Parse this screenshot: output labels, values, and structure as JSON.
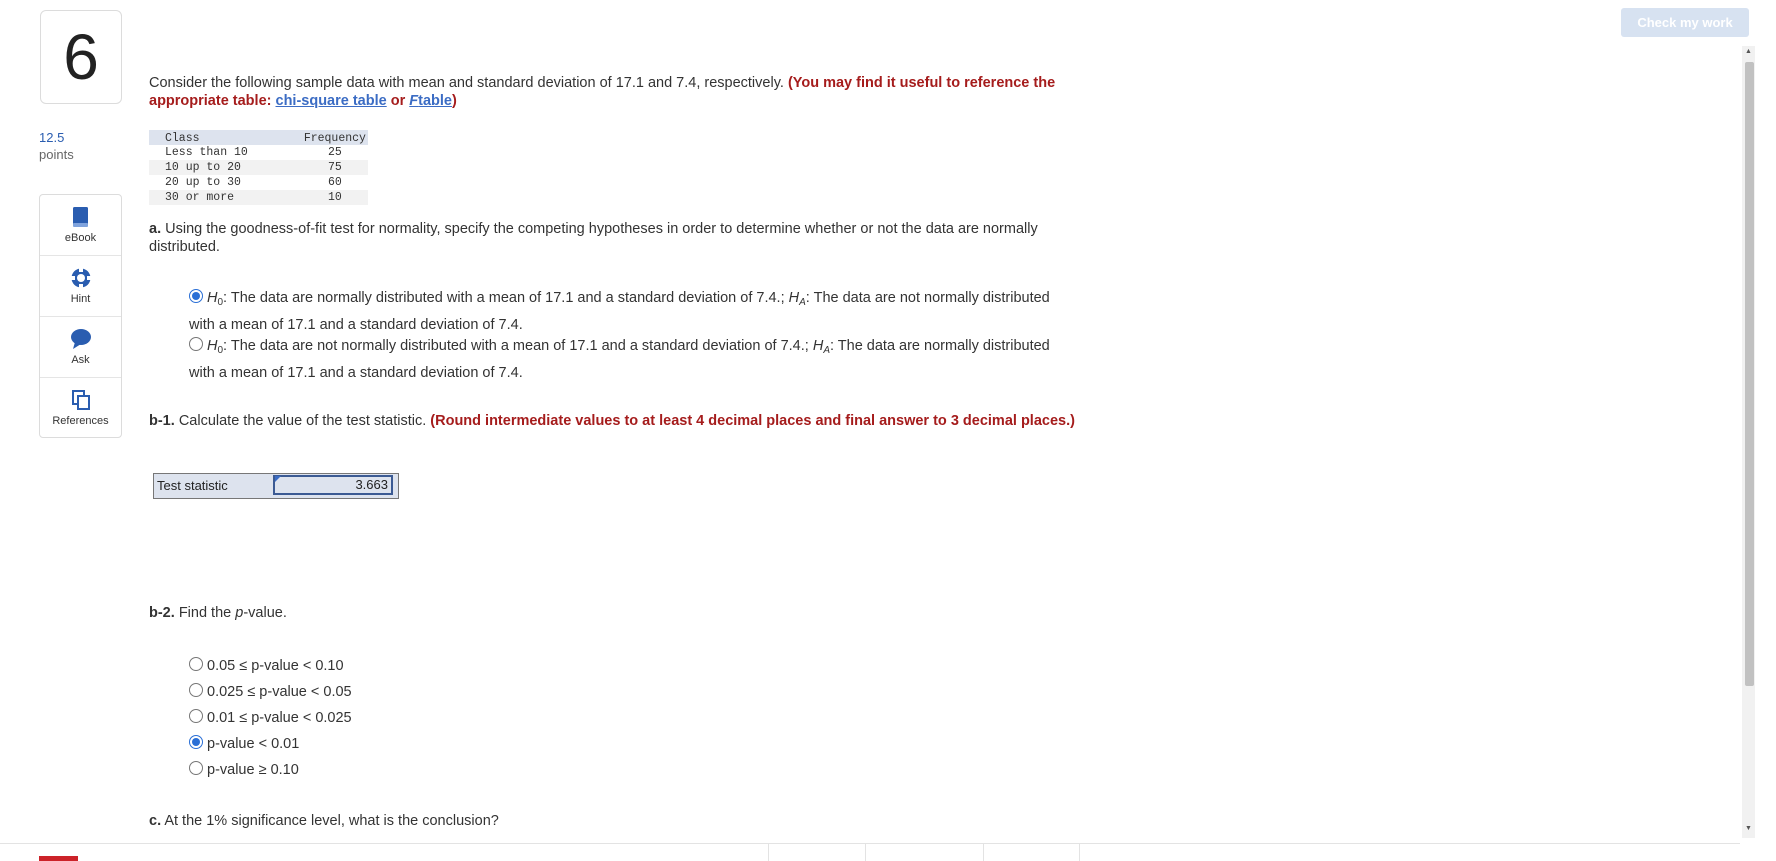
{
  "question": {
    "number": "6",
    "points_value": "12.5",
    "points_label": "points"
  },
  "header": {
    "check_button": "Check my work"
  },
  "tools": [
    {
      "label": "eBook",
      "icon": "book-icon"
    },
    {
      "label": "Hint",
      "icon": "lifebuoy-icon"
    },
    {
      "label": "Ask",
      "icon": "speech-bubble-icon"
    },
    {
      "label": "References",
      "icon": "copy-pages-icon"
    }
  ],
  "intro": {
    "text": "Consider the following sample data with mean and standard deviation of 17.1 and 7.4, respectively.",
    "ref_prefix": "(You may find it useful to reference the appropriate table:",
    "link1": "chi-square table",
    "or": "or",
    "link2_italic": "F",
    "link2_rest": "table",
    "ref_suffix": ")"
  },
  "table": {
    "headers": [
      "Class",
      "Frequency"
    ],
    "rows": [
      [
        "Less than 10",
        "25"
      ],
      [
        "10 up to 20",
        "75"
      ],
      [
        "20 up to 30",
        "60"
      ],
      [
        "30 or more",
        "10"
      ]
    ]
  },
  "part_a": {
    "label": "a.",
    "text": "Using the goodness-of-fit test for normality, specify the competing hypotheses in order to determine whether or not the data are normally distributed.",
    "options": [
      {
        "selected": true,
        "h0": "H",
        "h0_sub": "0",
        "h0_text": ": The data are normally distributed with a mean of 17.1 and a standard deviation of 7.4.;",
        "ha": "H",
        "ha_sub": "A",
        "ha_text": ": The data are not normally distributed with a mean of 17.1 and a standard deviation of 7.4."
      },
      {
        "selected": false,
        "h0": "H",
        "h0_sub": "0",
        "h0_text": ": The data are not normally distributed with a mean of 17.1 and a standard deviation of 7.4.;",
        "ha": "H",
        "ha_sub": "A",
        "ha_text": ": The data are normally distributed with a mean of 17.1 and a standard deviation of 7.4."
      }
    ]
  },
  "part_b1": {
    "label": "b-1.",
    "text": "Calculate the value of the test statistic.",
    "instruction": "(Round intermediate values to at least 4 decimal places and final answer to 3 decimal places.)",
    "field_label": "Test statistic",
    "field_value": "3.663"
  },
  "part_b2": {
    "label": "b-2.",
    "text_prefix": "Find the",
    "text_p": "p",
    "text_suffix": "-value.",
    "options": [
      {
        "text": "0.05 ≤ p-value < 0.10",
        "selected": false
      },
      {
        "text": "0.025 ≤ p-value < 0.05",
        "selected": false
      },
      {
        "text": "0.01 ≤ p-value < 0.025",
        "selected": false
      },
      {
        "text": "p-value < 0.01",
        "selected": true
      },
      {
        "text": "p-value ≥ 0.10",
        "selected": false
      }
    ]
  },
  "part_c": {
    "label": "c.",
    "text": "At the 1% significance level, what is the conclusion?"
  },
  "colors": {
    "accent_blue": "#2a6fd6",
    "instruction_red": "#a51c1c",
    "link_blue": "#3b6cc4",
    "check_button_bg": "#d7e2f1"
  }
}
